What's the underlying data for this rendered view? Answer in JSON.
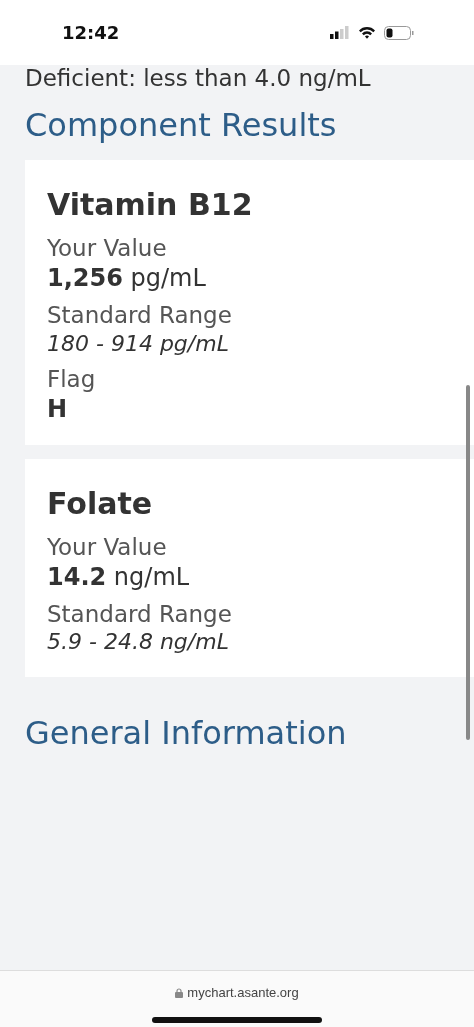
{
  "status_bar": {
    "time": "12:42"
  },
  "reference_note": "Deficient: less than 4.0 ng/mL",
  "component_results": {
    "title": "Component Results",
    "components": [
      {
        "name": "Vitamin B12",
        "fields": [
          {
            "kind": "measure",
            "label": "Your Value",
            "value": "**1,256** pg/mL"
          },
          {
            "kind": "range",
            "label": "Standard Range",
            "value": "180 - 914 pg/mL"
          },
          {
            "kind": "flag",
            "label": "Flag",
            "value": "H"
          }
        ]
      },
      {
        "name": "Folate",
        "fields": [
          {
            "kind": "measure",
            "label": "Your Value",
            "value": "**14.2** ng/mL"
          },
          {
            "kind": "range",
            "label": "Standard Range",
            "value": "5.9 - 24.8 ng/mL"
          }
        ]
      }
    ]
  },
  "general_information": {
    "title": "General Information"
  },
  "browser": {
    "url": "mychart.asante.org"
  }
}
